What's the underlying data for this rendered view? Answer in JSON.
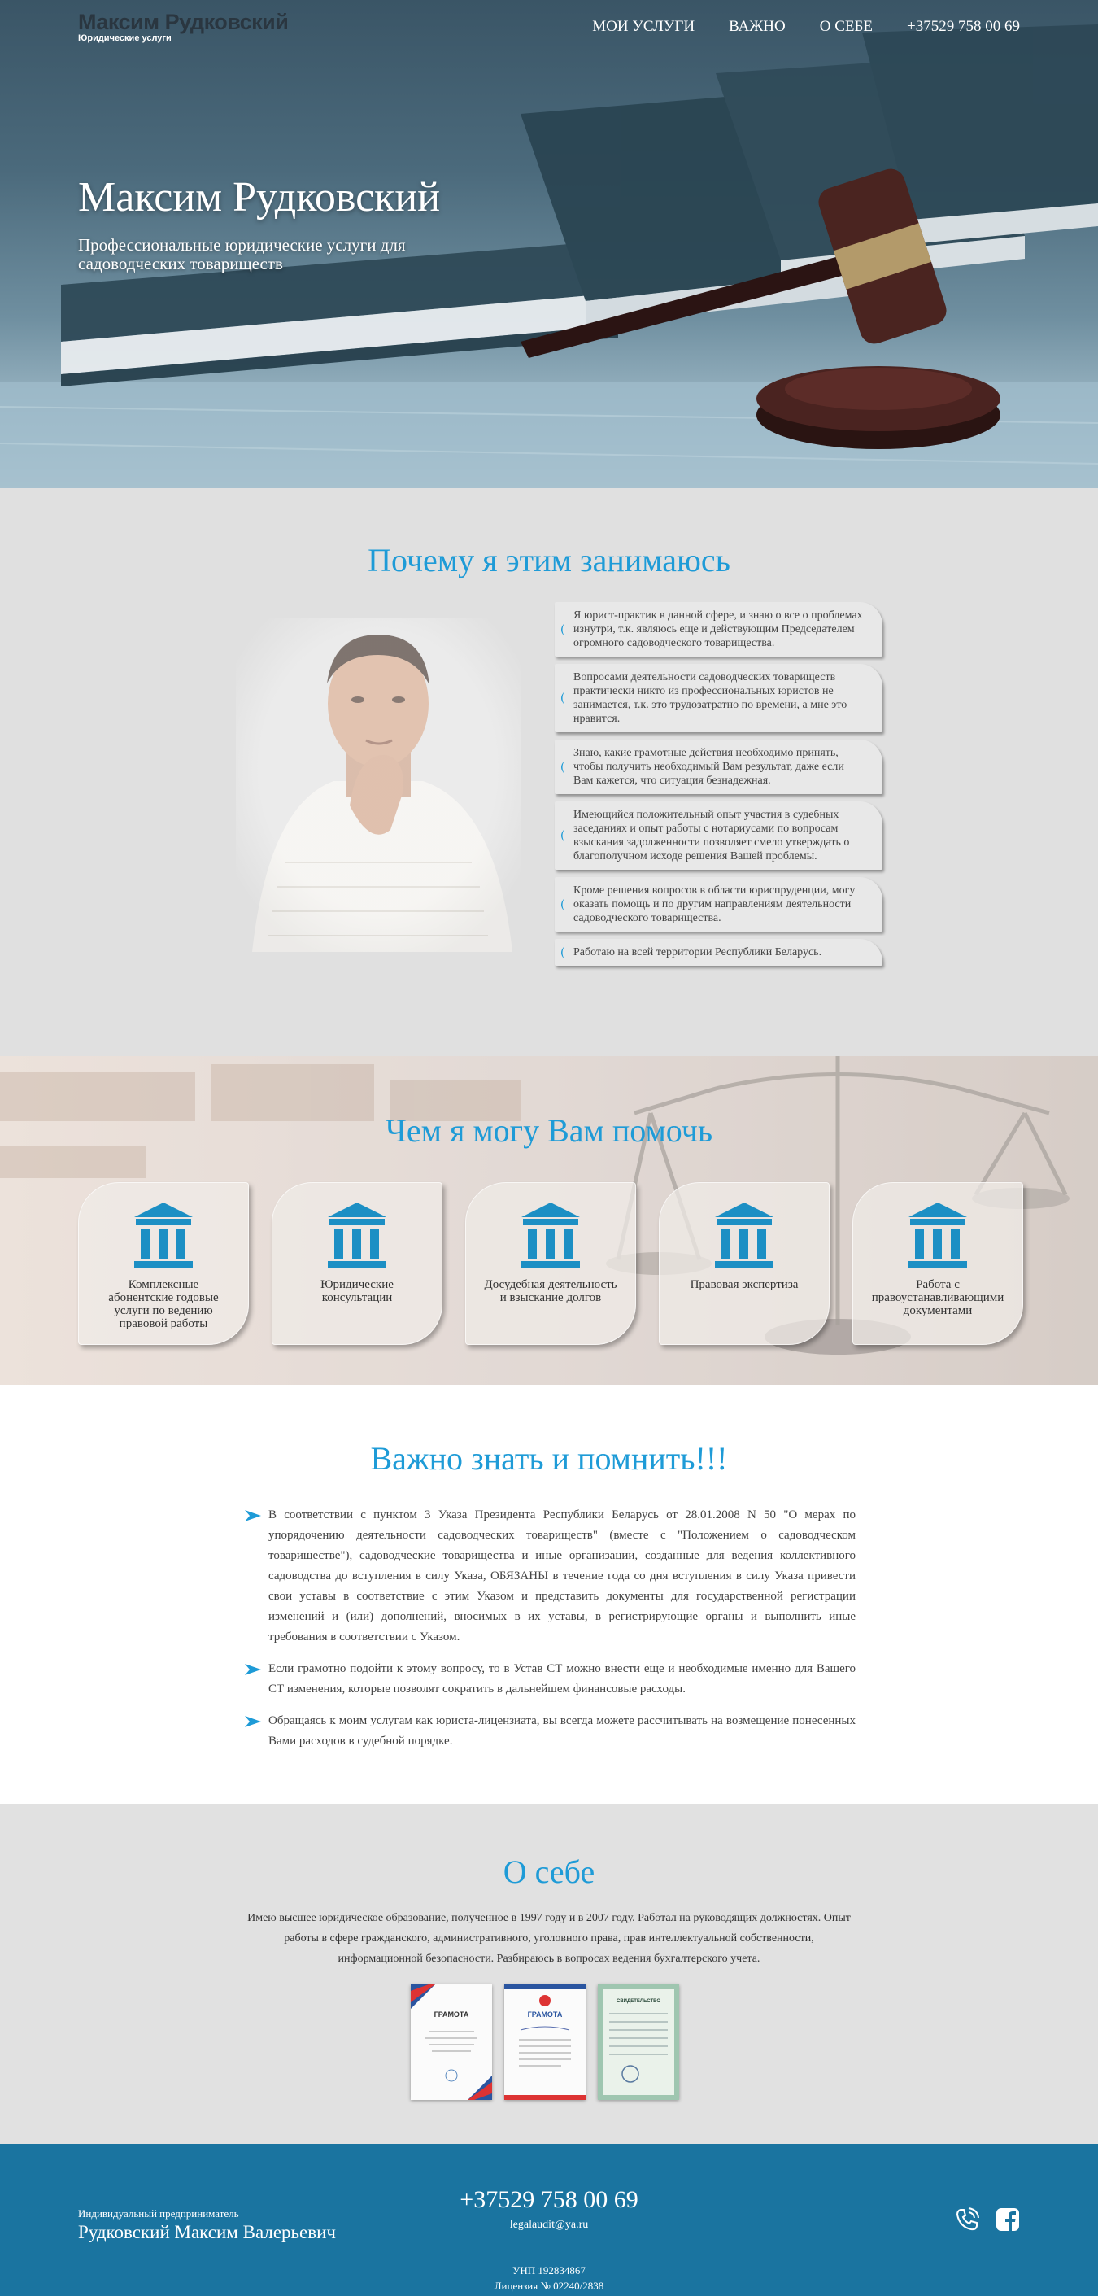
{
  "header": {
    "logo_name": "Максим Рудковский",
    "logo_sub": "Юридические услуги",
    "menu": [
      "МОИ УСЛУГИ",
      "ВАЖНО",
      "О СЕБЕ",
      "+37529 758 00 69"
    ]
  },
  "hero": {
    "title": "Максим Рудковский",
    "subtitle": "Профессиональные юридические услуги для садоводческих товариществ"
  },
  "why": {
    "title": "Почему я этим занимаюсь",
    "items": [
      "Я юрист-практик в данной сфере, и знаю о все о проблемах изнутри, т.к. являюсь еще и действующим Председателем огромного садоводческого товарищества.",
      "Вопросами деятельности садоводческих товариществ практически никто из профессиональных юристов не занимается, т.к. это трудозатратно по времени, а мне это нравится.",
      "Знаю, какие грамотные действия необходимо принять, чтобы получить необходимый Вам результат, даже если Вам кажется, что ситуация безнадежная.",
      "Имеющийся положительный опыт участия в судебных заседаниях и опыт работы с нотариусами по вопросам взыскания задолженности позволяет смело утверждать о благополучном исходе решения Вашей проблемы.",
      "Кроме решения вопросов в области юриспруденции, могу оказать помощь и по другим направлениям деятельности садоводческого товарищества.",
      "Работаю на всей территории Республики Беларусь."
    ]
  },
  "help": {
    "title": "Чем я могу Вам помочь",
    "cards": [
      "Комплексные абонентские годовые услуги по ведению правовой работы",
      "Юридические консультации",
      "Досудебная деятельность и взыскание долгов",
      "Правовая экспертиза",
      "Работа с правоустанавливающими документами"
    ]
  },
  "important": {
    "title": "Важно знать и помнить!!!",
    "paragraphs": [
      "В соответствии с пунктом 3 Указа Президента Республики Беларусь от 28.01.2008 N 50 \"О мерах по упорядочению деятельности садоводческих товариществ\" (вместе с \"Положением о садоводческом товариществе\"), садоводческие товарищества и иные организации, созданные для ведения коллективного садоводства до вступления в силу Указа, ОБЯЗАНЫ в течение года со дня вступления в силу Указа привести свои уставы в соответствие с этим Указом и представить документы для государственной регистрации изменений и (или) дополнений, вносимых в их уставы, в регистрирующие органы и выполнить иные требования в соответствии с Указом.",
      "Если грамотно подойти к этому вопросу, то в Устав СТ можно внести еще и необходимые именно для Вашего СТ изменения, которые позволят сократить в дальнейшем финансовые расходы.",
      "Обращаясь к моим услугам как юриста-лицензиата, вы всегда можете рассчитывать на возмещение понесенных Вами расходов в судебной порядке."
    ]
  },
  "about": {
    "title": "О себе",
    "text": "Имею высшее юридическое образование, полученное в 1997 году и в 2007 году. Работал на руководящих должностях. Опыт работы в сфере гражданского, административного, уголовного права, прав интеллектуальной собственности, информационной безопасности. Разбираюсь в вопросах ведения бухгалтерского учета.",
    "certificates": [
      "ГРАМОТА",
      "ГРАМОТА",
      "СВИДЕТЕЛЬСТВО"
    ]
  },
  "footer": {
    "ip_label": "Индивидуальный предприниматель",
    "name": "Рудковский Максим Валерьевич",
    "phone": "+37529 758 00 69",
    "email": "legalaudit@ya.ru",
    "unp": "УНП 192834867",
    "license": "Лицензия № 02240/2838",
    "icons": [
      "phone-icon",
      "facebook-icon"
    ]
  },
  "colors": {
    "accent": "#1e9bd7",
    "footer_bg": "#1a74a0",
    "section_gray": "#e0e0e0",
    "icon_blue": "#1c8fc4"
  }
}
